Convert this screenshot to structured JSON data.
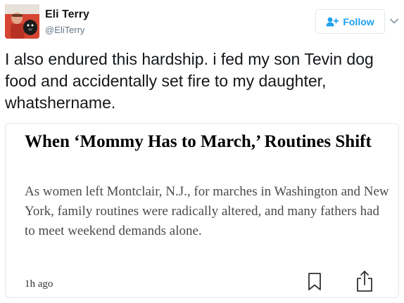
{
  "user": {
    "name": "Eli Terry",
    "handle": "@EliTerry",
    "avatar_icon": "user-photo-avatar"
  },
  "follow_button": {
    "label": "Follow",
    "icon": "add-user-icon",
    "color": "#1da1f2"
  },
  "caret_icon": "chevron-down-icon",
  "tweet": {
    "text": "I also endured this hardship. i fed my son Tevin dog food and accidentally set fire to my daughter, whatshername."
  },
  "card": {
    "title": "When ‘Mommy Has to March,’ Routines Shift",
    "description": "As women left Montclair, N.J., for marches in Washington and New York, family routines were radically altered, and many fathers had to meet weekend demands alone.",
    "timestamp": "1h ago",
    "bookmark_icon": "bookmark-icon",
    "share_icon": "share-icon"
  }
}
